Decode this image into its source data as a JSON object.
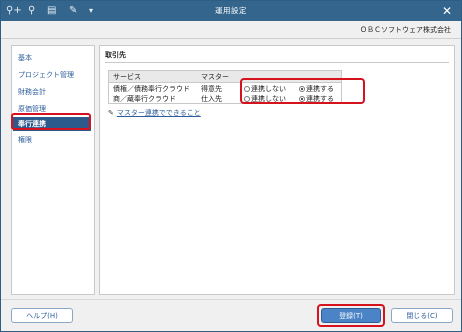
{
  "window": {
    "title": "運用設定",
    "company": "ＯＢＣソフトウェア株式会社"
  },
  "toolbar": [
    "search-plus-icon",
    "search-icon",
    "print-icon",
    "tool-icon",
    "dropdown-icon"
  ],
  "sidebar": {
    "items": [
      {
        "label": "基本",
        "active": false
      },
      {
        "label": "プロジェクト管理",
        "active": false
      },
      {
        "label": "財務会計",
        "active": false
      },
      {
        "label": "原価管理",
        "active": false
      },
      {
        "label": "奉行連携",
        "active": true
      },
      {
        "label": "権限",
        "active": false
      }
    ]
  },
  "main": {
    "section_title": "取引先",
    "table": {
      "headers": [
        "サービス",
        "マスター"
      ],
      "rows": [
        {
          "service": "債権／債務奉行クラウド",
          "master": "得意先",
          "option_off": "連携しない",
          "option_on": "連携する",
          "selected": "on"
        },
        {
          "service": "商／蔵奉行クラウド",
          "master": "仕入先",
          "option_off": "連携しない",
          "option_on": "連携する",
          "selected": "on"
        }
      ]
    },
    "link_text": "マスター連携でできること"
  },
  "footer": {
    "help": "ヘルプ(H)",
    "register": "登録(T)",
    "close": "閉じる(C)"
  },
  "colors": {
    "titlebar": "#34658c",
    "active": "#2c5a8c",
    "highlight": "#d6121e",
    "primary": "#4a83c6"
  }
}
